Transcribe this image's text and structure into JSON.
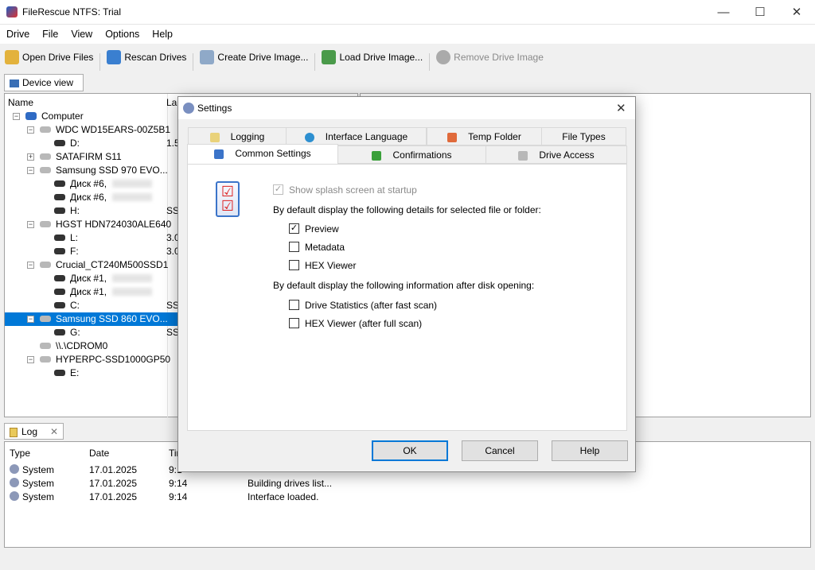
{
  "window": {
    "title": "FileRescue NTFS: Trial",
    "minimize": "—",
    "maximize": "☐",
    "close": "✕"
  },
  "menu": [
    "Drive",
    "File",
    "View",
    "Options",
    "Help"
  ],
  "toolbar": [
    {
      "label": "Open Drive Files",
      "icon": "folder-icon",
      "enabled": true
    },
    {
      "label": "Rescan Drives",
      "icon": "refresh-icon",
      "enabled": true
    },
    {
      "label": "Create Drive Image...",
      "icon": "create-image-icon",
      "enabled": true
    },
    {
      "label": "Load Drive Image...",
      "icon": "load-image-icon",
      "enabled": true
    },
    {
      "label": "Remove Drive Image",
      "icon": "remove-image-icon",
      "enabled": false
    }
  ],
  "device_view": {
    "tab": "Device view",
    "columns": [
      "Name",
      "Lab"
    ],
    "tree": [
      {
        "name": "Computer",
        "level": 0,
        "type": "computer",
        "exp": "−"
      },
      {
        "name": "WDC WD15EARS-00Z5B1",
        "level": 1,
        "type": "drive",
        "exp": "−"
      },
      {
        "name": "D:",
        "level": 2,
        "type": "part",
        "label": "1.5"
      },
      {
        "name": "SATAFIRM   S11",
        "level": 1,
        "type": "drive",
        "exp": "+"
      },
      {
        "name": "Samsung SSD 970 EVO...",
        "level": 1,
        "type": "drive",
        "exp": "−"
      },
      {
        "name": "Диск #6,",
        "level": 2,
        "type": "part",
        "blur": true
      },
      {
        "name": "Диск #6,",
        "level": 2,
        "type": "part",
        "blur": true
      },
      {
        "name": "H:",
        "level": 2,
        "type": "part",
        "label": "SSI"
      },
      {
        "name": "HGST HDN724030ALE640",
        "level": 1,
        "type": "drive",
        "exp": "−"
      },
      {
        "name": "L:",
        "level": 2,
        "type": "part",
        "label": "3.0"
      },
      {
        "name": "F:",
        "level": 2,
        "type": "part",
        "label": "3.0"
      },
      {
        "name": "Crucial_CT240M500SSD1",
        "level": 1,
        "type": "drive",
        "exp": "−"
      },
      {
        "name": "Диск #1,",
        "level": 2,
        "type": "part",
        "blur": true
      },
      {
        "name": "Диск #1,",
        "level": 2,
        "type": "part",
        "blur": true
      },
      {
        "name": "C:",
        "level": 2,
        "type": "part",
        "label": "SSI"
      },
      {
        "name": "Samsung SSD 860 EVO...",
        "level": 1,
        "type": "drive",
        "exp": "−",
        "selected": true
      },
      {
        "name": "G:",
        "level": 2,
        "type": "part",
        "label": "SSI"
      },
      {
        "name": "\\\\.\\CDROM0",
        "level": 1,
        "type": "drive"
      },
      {
        "name": "HYPERPC-SSD1000GP50",
        "level": 1,
        "type": "drive",
        "exp": "−"
      },
      {
        "name": "E:",
        "level": 2,
        "type": "part"
      }
    ]
  },
  "log": {
    "tab": "Log",
    "close": "✕",
    "columns": [
      "Type",
      "Date",
      "Tim"
    ],
    "rows": [
      {
        "type": "System",
        "date": "17.01.2025",
        "time": "9:1",
        "message": ""
      },
      {
        "type": "System",
        "date": "17.01.2025",
        "time": "9:14",
        "message": "Building drives list..."
      },
      {
        "type": "System",
        "date": "17.01.2025",
        "time": "9:14",
        "message": "Interface loaded."
      }
    ]
  },
  "dialog": {
    "title": "Settings",
    "close": "✕",
    "tabs_row1": [
      "Logging",
      "Interface Language",
      "Temp Folder",
      "File Types"
    ],
    "tabs_row2": [
      "Common Settings",
      "Confirmations",
      "Drive Access"
    ],
    "active_tab": "Common Settings",
    "splash": {
      "label": "Show splash screen at startup",
      "checked": true,
      "enabled": false
    },
    "section1": "By default display the following details for selected file or folder:",
    "details": [
      {
        "label": "Preview",
        "checked": true
      },
      {
        "label": "Metadata",
        "checked": false
      },
      {
        "label": "HEX Viewer",
        "checked": false
      }
    ],
    "section2": "By default display the following information after disk opening:",
    "after_open": [
      {
        "label": "Drive Statistics (after fast scan)",
        "checked": false
      },
      {
        "label": "HEX Viewer (after full scan)",
        "checked": false
      }
    ],
    "buttons": {
      "ok": "OK",
      "cancel": "Cancel",
      "help": "Help"
    }
  }
}
